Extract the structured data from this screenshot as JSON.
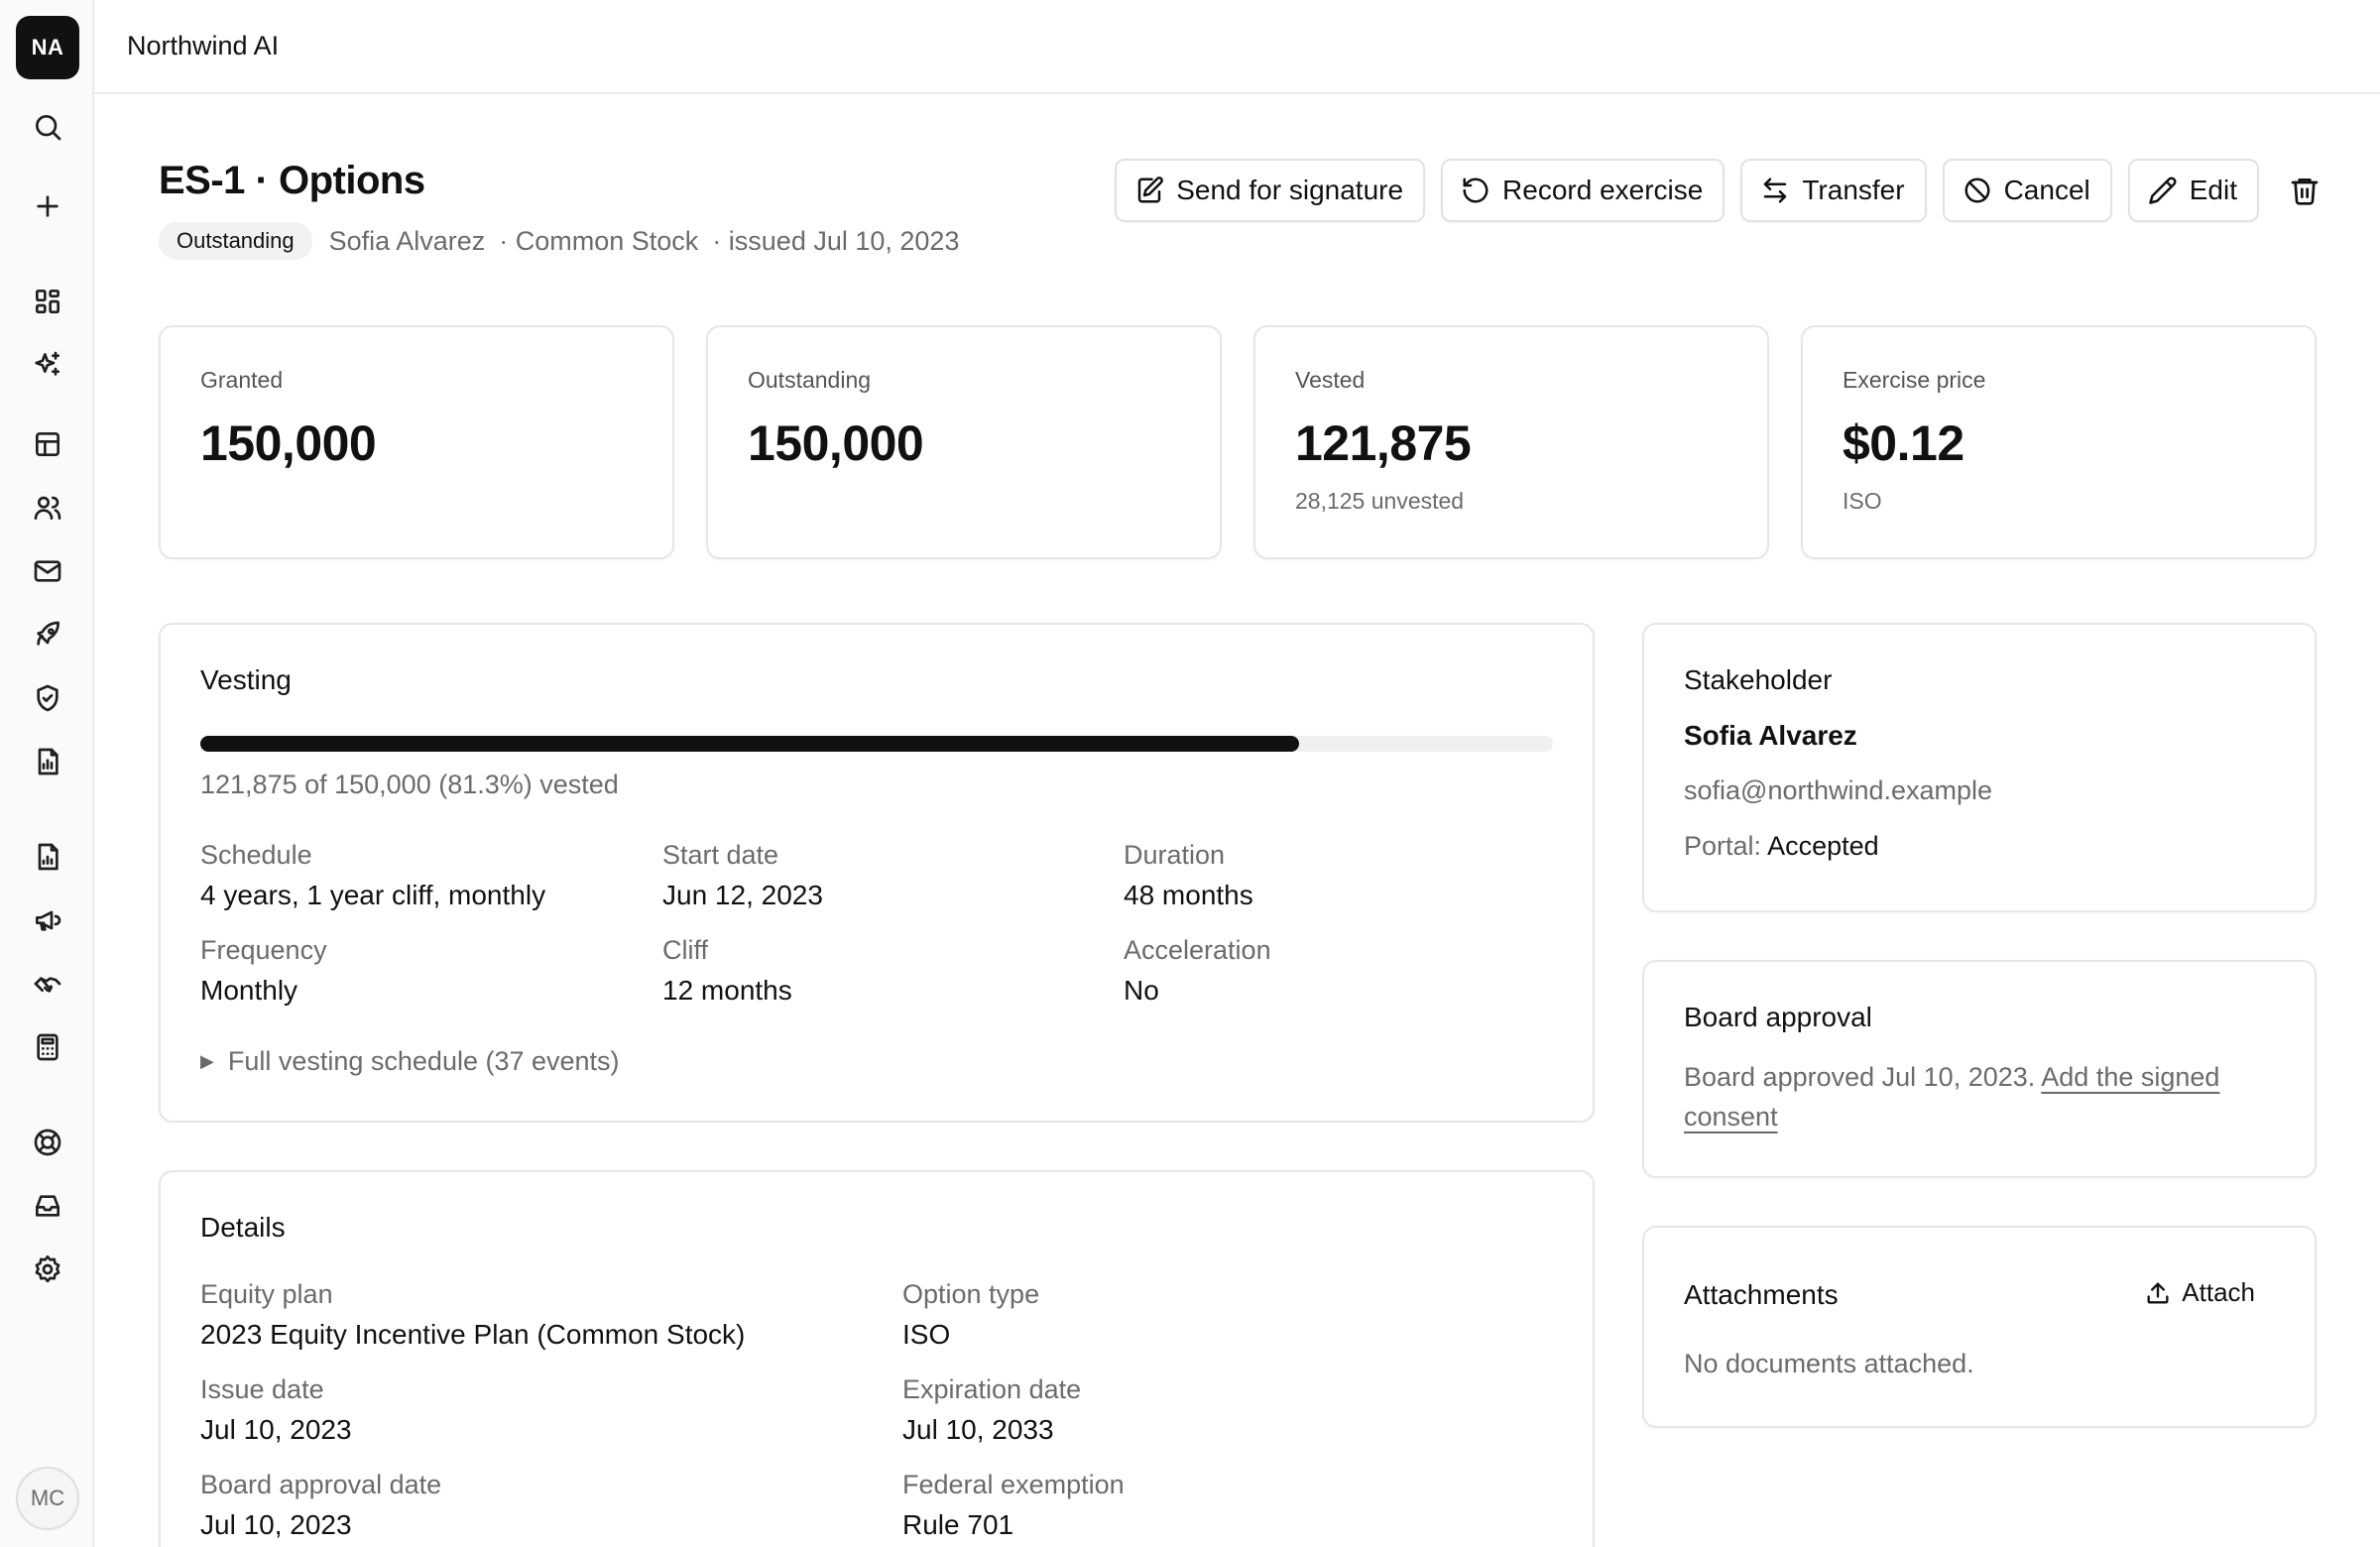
{
  "sidebar": {
    "logo": "NA",
    "avatar": "MC",
    "items": [
      {
        "icon": "search-icon"
      },
      {
        "icon": "plus-icon"
      },
      {
        "icon": "dashboard-icon"
      },
      {
        "icon": "sparkles-icon"
      },
      {
        "icon": "table-icon"
      },
      {
        "icon": "users-icon"
      },
      {
        "icon": "mail-icon"
      },
      {
        "icon": "rocket-icon"
      },
      {
        "icon": "shield-check-icon"
      },
      {
        "icon": "report-icon"
      },
      {
        "icon": "chart-file-icon"
      },
      {
        "icon": "megaphone-icon"
      },
      {
        "icon": "handshake-icon"
      },
      {
        "icon": "calculator-icon"
      },
      {
        "icon": "lifebuoy-icon"
      },
      {
        "icon": "inbox-icon"
      },
      {
        "icon": "settings-icon"
      }
    ]
  },
  "topbar": {
    "org_name": "Northwind AI"
  },
  "header": {
    "title": "ES-1 · Options",
    "status_badge": "Outstanding",
    "stakeholder": "Sofia Alvarez",
    "share_class": "· Common Stock",
    "issued": "· issued Jul 10, 2023"
  },
  "actions": {
    "send_for_signature": "Send for signature",
    "record_exercise": "Record exercise",
    "transfer": "Transfer",
    "cancel": "Cancel",
    "edit": "Edit"
  },
  "stats": {
    "granted": {
      "label": "Granted",
      "value": "150,000"
    },
    "outstanding": {
      "label": "Outstanding",
      "value": "150,000"
    },
    "vested": {
      "label": "Vested",
      "value": "121,875",
      "sub": "28,125 unvested"
    },
    "exercise_price": {
      "label": "Exercise price",
      "value": "$0.12",
      "sub": "ISO"
    }
  },
  "vesting": {
    "title": "Vesting",
    "progress_fraction": 0.8125,
    "progress_text": "121,875 of 150,000 (81.3%) vested",
    "schedule_label": "Schedule",
    "schedule_value": "4 years, 1 year cliff, monthly",
    "start_label": "Start date",
    "start_value": "Jun 12, 2023",
    "duration_label": "Duration",
    "duration_value": "48 months",
    "frequency_label": "Frequency",
    "frequency_value": "Monthly",
    "cliff_label": "Cliff",
    "cliff_value": "12 months",
    "acceleration_label": "Acceleration",
    "acceleration_value": "No",
    "full_schedule": "Full vesting schedule (37 events)"
  },
  "details": {
    "title": "Details",
    "equity_plan_label": "Equity plan",
    "equity_plan_value": "2023 Equity Incentive Plan (Common Stock)",
    "option_type_label": "Option type",
    "option_type_value": "ISO",
    "issue_date_label": "Issue date",
    "issue_date_value": "Jul 10, 2023",
    "expiration_label": "Expiration date",
    "expiration_value": "Jul 10, 2033",
    "board_date_label": "Board approval date",
    "board_date_value": "Jul 10, 2023",
    "exemption_label": "Federal exemption",
    "exemption_value": "Rule 701"
  },
  "stakeholder_card": {
    "title": "Stakeholder",
    "name": "Sofia Alvarez",
    "email": "sofia@northwind.example",
    "portal_label": "Portal:",
    "portal_value": "Accepted"
  },
  "board_approval": {
    "title": "Board approval",
    "text": "Board approved Jul 10, 2023.",
    "link_line1": "Add the signed",
    "link_line2": "consent"
  },
  "attachments": {
    "title": "Attachments",
    "attach_label": "Attach",
    "empty_text": "No documents attached."
  }
}
